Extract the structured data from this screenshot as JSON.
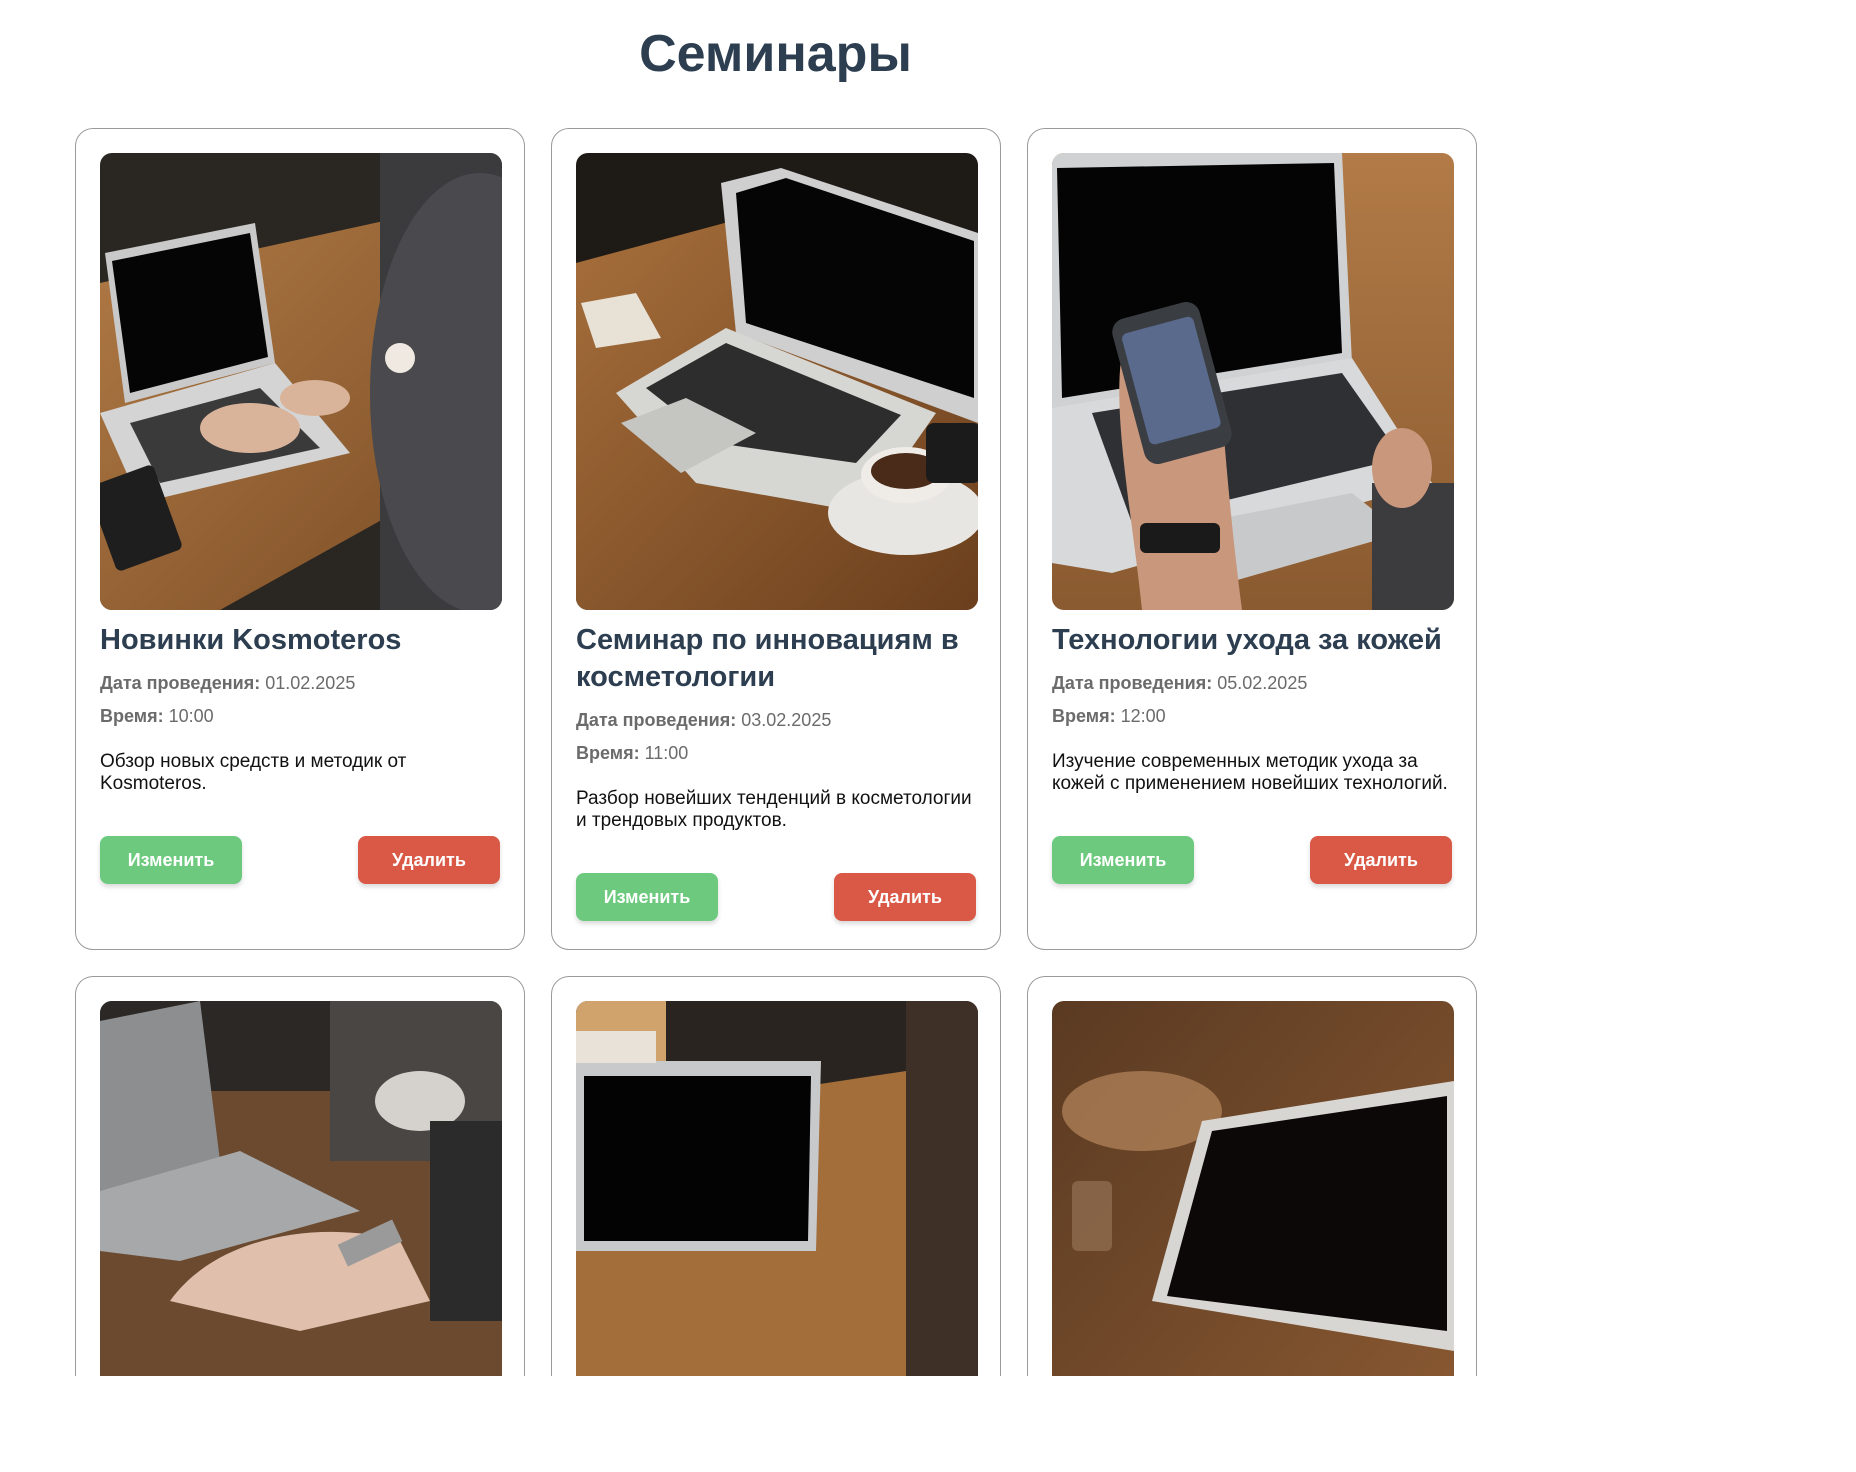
{
  "page": {
    "title": "Семинары"
  },
  "labels": {
    "date": "Дата проведения:",
    "time": "Время:",
    "edit": "Изменить",
    "delete": "Удалить"
  },
  "seminars": [
    {
      "title": "Новинки Kosmoteros",
      "date": "01.02.2025",
      "time": "10:00",
      "description": "Обзор новых средств и методик от Kosmoteros."
    },
    {
      "title": "Семинар по инновациям в косметологии",
      "date": "03.02.2025",
      "time": "11:00",
      "description": "Разбор новейших тенденций в косметологии и трендовых продуктов."
    },
    {
      "title": "Технологии ухода за кожей",
      "date": "05.02.2025",
      "time": "12:00",
      "description": "Изучение современных методик ухода за кожей с применением новейших технологий."
    }
  ],
  "colors": {
    "heading": "#2c3e50",
    "edit_button": "#6cc97d",
    "delete_button": "#d95846"
  }
}
